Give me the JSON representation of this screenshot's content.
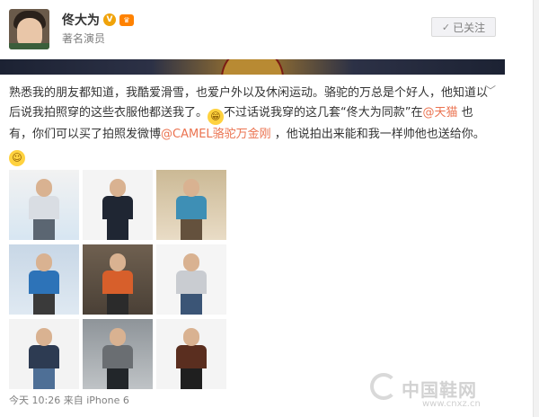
{
  "user": {
    "name": "佟大为",
    "verified_icon": "verified-v-icon",
    "member_icon": "weibo-member-icon",
    "title": "著名演员",
    "follow_label": "已关注"
  },
  "post": {
    "text_1": "熟悉我的朋友都知道，我酷爱滑雪，也爱户外以及休闲运动。骆驼的万总是个好人，他知道以后说我拍照穿的这些衣服他都送我了。",
    "emoji_1": "grin-emoji",
    "text_2": "不过话说我穿的这几套“佟大为同款”在",
    "mention_1": "@天猫",
    "text_3": " 也有，你们可以买了拍照发微博",
    "mention_2": "@CAMEL骆驼万金刚",
    "text_4": " ，他说拍出来能和我一样帅他也送给你。",
    "emoji_2": "shy-emoji"
  },
  "gallery": {
    "photos": [
      {
        "name": "photo-ski-mountain",
        "colors": {
          "bg": "#d7e6f2",
          "top": "#f2f2f2",
          "body": "#d9dde3",
          "legs": "#5b6672"
        }
      },
      {
        "name": "photo-dark-shirt",
        "colors": {
          "bg": "#f4f4f4",
          "top": "#f4f4f4",
          "body": "#1f2633",
          "legs": "#1f2633"
        }
      },
      {
        "name": "photo-hiker-backpack",
        "colors": {
          "bg": "#e9dcc6",
          "top": "#cbb995",
          "body": "#3e8fb5",
          "legs": "#64513d"
        }
      },
      {
        "name": "photo-red-jacket-snow",
        "colors": {
          "bg": "#dfe9f2",
          "top": "#c8d7e6",
          "body": "#2d73b8",
          "legs": "#3a3a3a"
        }
      },
      {
        "name": "photo-orange-down-jacket",
        "colors": {
          "bg": "#4a4036",
          "top": "#6f6050",
          "body": "#d75f2b",
          "legs": "#2b2b2b"
        }
      },
      {
        "name": "photo-grey-sweater",
        "colors": {
          "bg": "#f5f5f5",
          "top": "#f5f5f5",
          "body": "#c9ccd1",
          "legs": "#3b5576"
        }
      },
      {
        "name": "photo-jeans-stool",
        "colors": {
          "bg": "#f3f3f3",
          "top": "#f3f3f3",
          "body": "#2d3b52",
          "legs": "#4e6f96"
        }
      },
      {
        "name": "photo-jeep",
        "colors": {
          "bg": "#bfc3c6",
          "top": "#8e9499",
          "body": "#6a6e72",
          "legs": "#22262a"
        }
      },
      {
        "name": "photo-leather-jacket",
        "colors": {
          "bg": "#f4f4f4",
          "top": "#f4f4f4",
          "body": "#5a2e1f",
          "legs": "#1f1f1f"
        }
      }
    ]
  },
  "footer": {
    "time": "今天 10:26",
    "source_prefix": "来自",
    "source": "iPhone 6"
  },
  "watermark": {
    "brand": "中国鞋网",
    "url": "www.cnxz.cn"
  }
}
